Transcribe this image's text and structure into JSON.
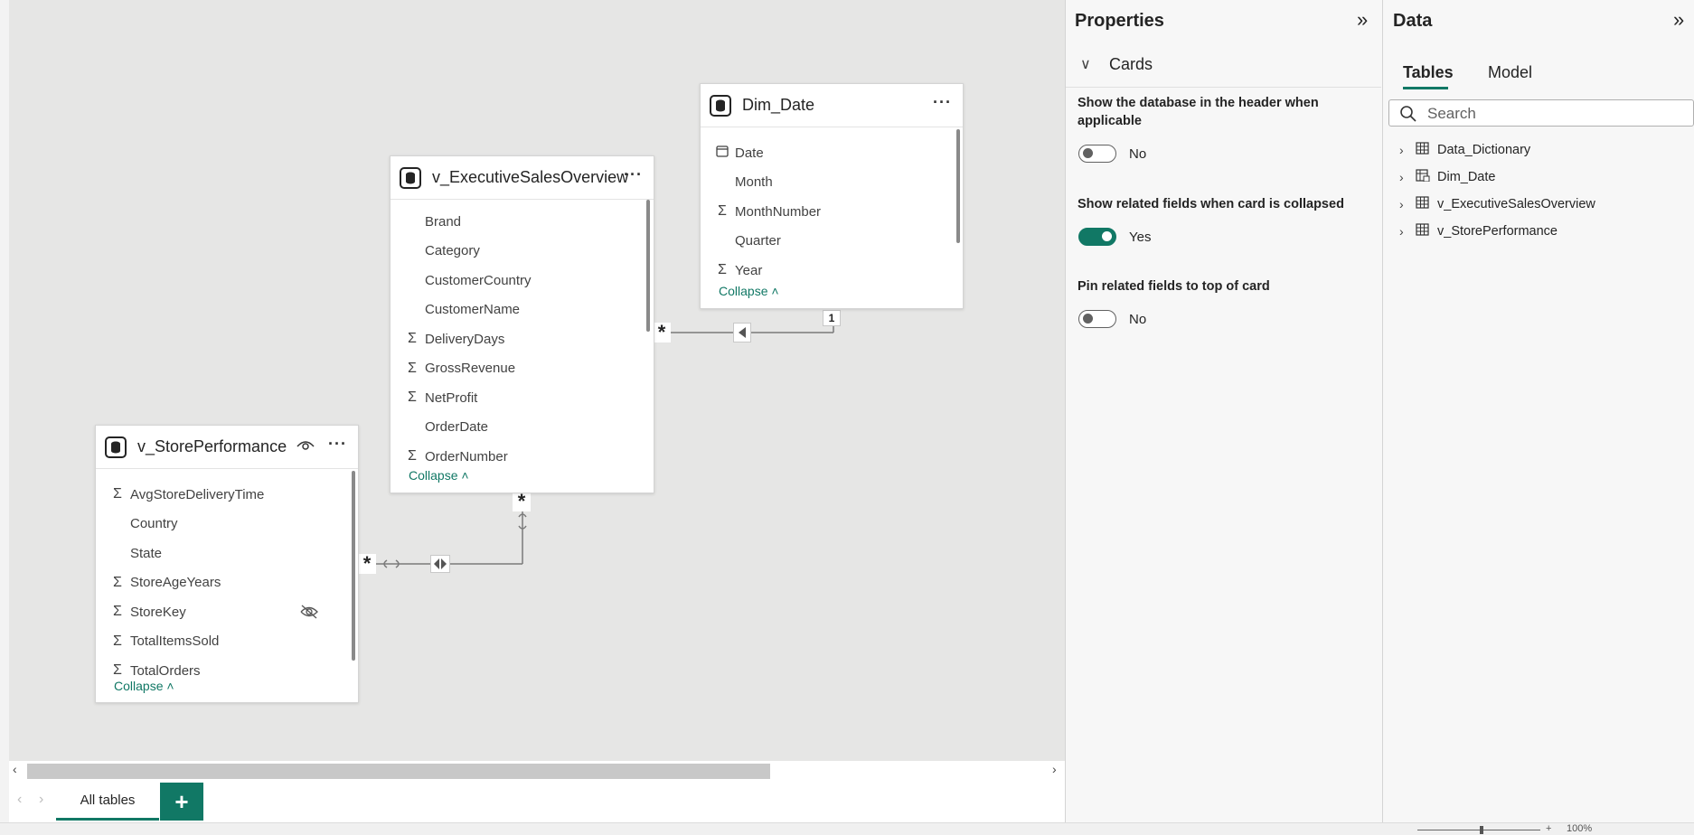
{
  "canvas": {
    "executive_card": {
      "title": "v_ExecutiveSalesOverview",
      "fields": [
        {
          "name": "Brand",
          "sigma": false
        },
        {
          "name": "Category",
          "sigma": false
        },
        {
          "name": "CustomerCountry",
          "sigma": false
        },
        {
          "name": "CustomerName",
          "sigma": false
        },
        {
          "name": "DeliveryDays",
          "sigma": true
        },
        {
          "name": "GrossRevenue",
          "sigma": true
        },
        {
          "name": "NetProfit",
          "sigma": true
        },
        {
          "name": "OrderDate",
          "sigma": false
        },
        {
          "name": "OrderNumber",
          "sigma": true
        }
      ],
      "collapse_label": "Collapse"
    },
    "date_card": {
      "title": "Dim_Date",
      "fields": [
        {
          "name": "Date",
          "icon": "calendar-icon"
        },
        {
          "name": "Month",
          "icon": ""
        },
        {
          "name": "MonthNumber",
          "icon": "sigma"
        },
        {
          "name": "Quarter",
          "icon": ""
        },
        {
          "name": "Year",
          "icon": "sigma"
        }
      ],
      "collapse_label": "Collapse"
    },
    "store_card": {
      "title": "v_StorePerformance",
      "fields": [
        {
          "name": "AvgStoreDeliveryTime",
          "sigma": true,
          "hidden": false
        },
        {
          "name": "Country",
          "sigma": false,
          "hidden": false
        },
        {
          "name": "State",
          "sigma": false,
          "hidden": false
        },
        {
          "name": "StoreAgeYears",
          "sigma": true,
          "hidden": false
        },
        {
          "name": "StoreKey",
          "sigma": true,
          "hidden": true
        },
        {
          "name": "TotalItemsSold",
          "sigma": true,
          "hidden": false
        },
        {
          "name": "TotalOrders",
          "sigma": true,
          "hidden": false
        }
      ],
      "collapse_label": "Collapse"
    },
    "relationships": {
      "many_marker": "*",
      "one_marker": "1"
    }
  },
  "tabs": {
    "all_tables": "All tables",
    "add": "+"
  },
  "properties": {
    "title": "Properties",
    "section": "Cards",
    "settings": [
      {
        "label": "Show the database in the header when applicable",
        "on": false,
        "value": "No"
      },
      {
        "label": "Show related fields when card is collapsed",
        "on": true,
        "value": "Yes"
      },
      {
        "label": "Pin related fields to top of card",
        "on": false,
        "value": "No"
      }
    ]
  },
  "data_pane": {
    "title": "Data",
    "tabs": [
      "Tables",
      "Model"
    ],
    "active_tab": "Tables",
    "search_placeholder": "Search",
    "tables": [
      {
        "name": "Data_Dictionary",
        "icon": "table-icon"
      },
      {
        "name": "Dim_Date",
        "icon": "date-table-icon"
      },
      {
        "name": "v_ExecutiveSalesOverview",
        "icon": "table-icon"
      },
      {
        "name": "v_StorePerformance",
        "icon": "table-icon"
      }
    ]
  },
  "status": {
    "zoom": "100%"
  },
  "colors": {
    "accent": "#117865",
    "canvas": "#e6e6e5"
  }
}
